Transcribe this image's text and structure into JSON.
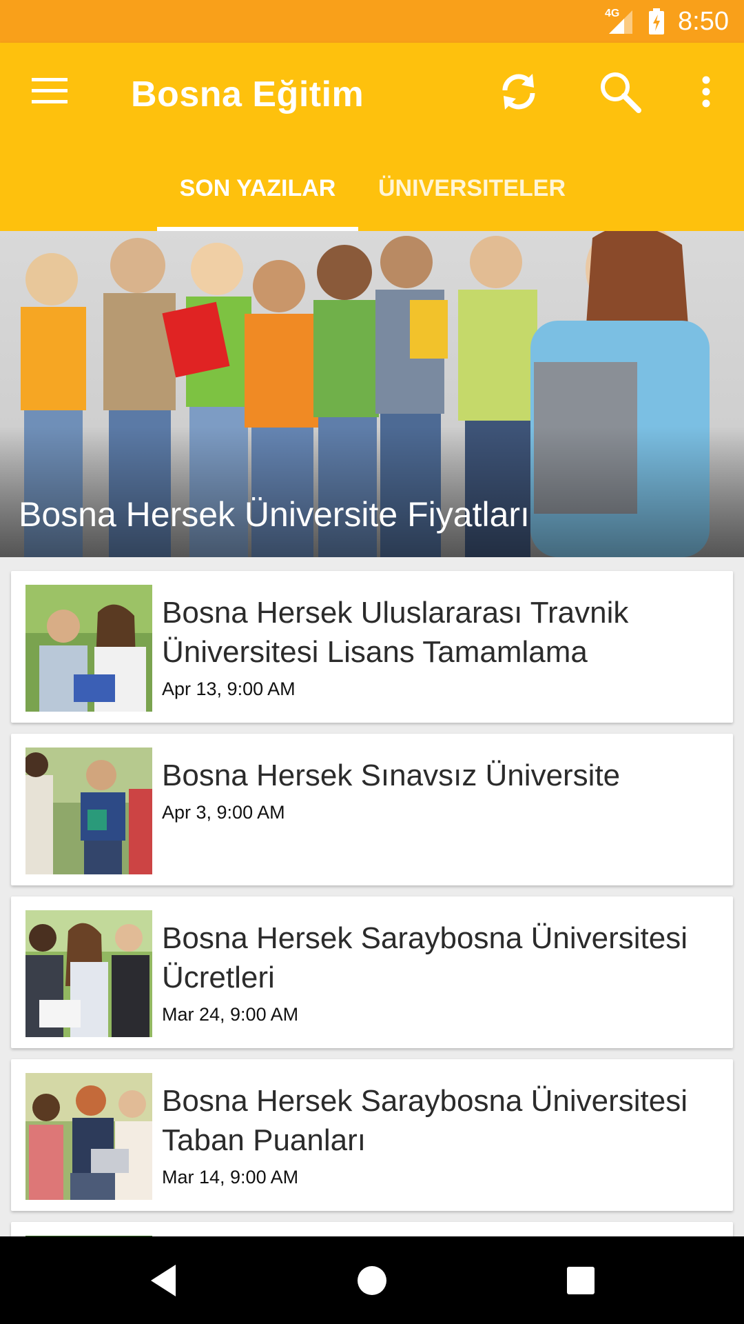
{
  "status_bar": {
    "network": "4G",
    "time": "8:50"
  },
  "app_bar": {
    "title": "Bosna Eğitim",
    "icons": [
      "menu-icon",
      "refresh-icon",
      "search-icon",
      "more-vert-icon"
    ],
    "background": "#fec10d"
  },
  "tabs": [
    {
      "label": "SON YAZILAR",
      "selected": true
    },
    {
      "label": "ÜNIVERSITELER",
      "selected": false
    }
  ],
  "featured": {
    "title": "Bosna Hersek Üniversite Fiyatları"
  },
  "articles": [
    {
      "title": "Bosna Hersek Uluslararası Travnik Üniversitesi Lisans Tamamlama",
      "date": "Apr 13, 9:00 AM"
    },
    {
      "title": "Bosna Hersek Sınavsız Üniversite",
      "date": "Apr 3, 9:00 AM"
    },
    {
      "title": "Bosna Hersek Saraybosna Üniversitesi Ücretleri",
      "date": "Mar 24, 9:00 AM"
    },
    {
      "title": "Bosna Hersek Saraybosna Üniversitesi Taban Puanları",
      "date": "Mar 14, 9:00 AM"
    }
  ],
  "colors": {
    "status_bar": "#f9a01a",
    "app_bar": "#fec10d",
    "text_on_accent": "#ffffff"
  }
}
